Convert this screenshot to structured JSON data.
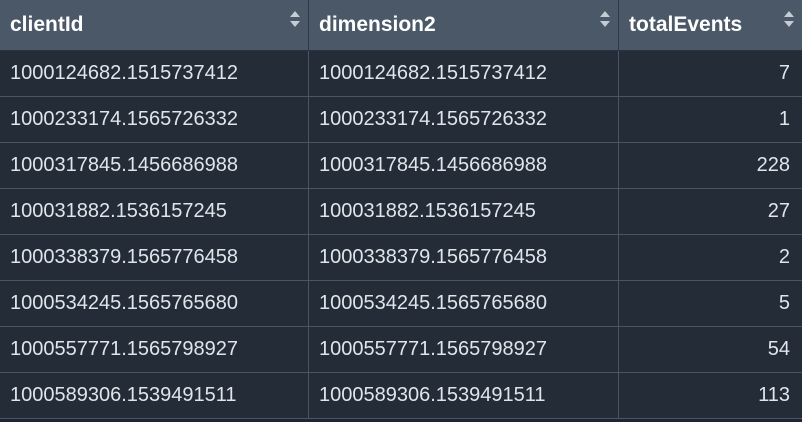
{
  "columns": [
    {
      "label": "clientId"
    },
    {
      "label": "dimension2"
    },
    {
      "label": "totalEvents"
    }
  ],
  "rows": [
    {
      "clientId": "1000124682.1515737412",
      "dimension2": "1000124682.1515737412",
      "totalEvents": "7"
    },
    {
      "clientId": "1000233174.1565726332",
      "dimension2": "1000233174.1565726332",
      "totalEvents": "1"
    },
    {
      "clientId": "1000317845.1456686988",
      "dimension2": "1000317845.1456686988",
      "totalEvents": "228"
    },
    {
      "clientId": "100031882.1536157245",
      "dimension2": "100031882.1536157245",
      "totalEvents": "27"
    },
    {
      "clientId": "1000338379.1565776458",
      "dimension2": "1000338379.1565776458",
      "totalEvents": "2"
    },
    {
      "clientId": "1000534245.1565765680",
      "dimension2": "1000534245.1565765680",
      "totalEvents": "5"
    },
    {
      "clientId": "1000557771.1565798927",
      "dimension2": "1000557771.1565798927",
      "totalEvents": "54"
    },
    {
      "clientId": "1000589306.1539491511",
      "dimension2": "1000589306.1539491511",
      "totalEvents": "113"
    }
  ],
  "icons": {
    "sort": "sort-icon"
  },
  "colors": {
    "header_bg": "#4b5868",
    "body_bg": "#232c37",
    "grid_line": "#4a5563",
    "text": "#dfe5eb"
  }
}
